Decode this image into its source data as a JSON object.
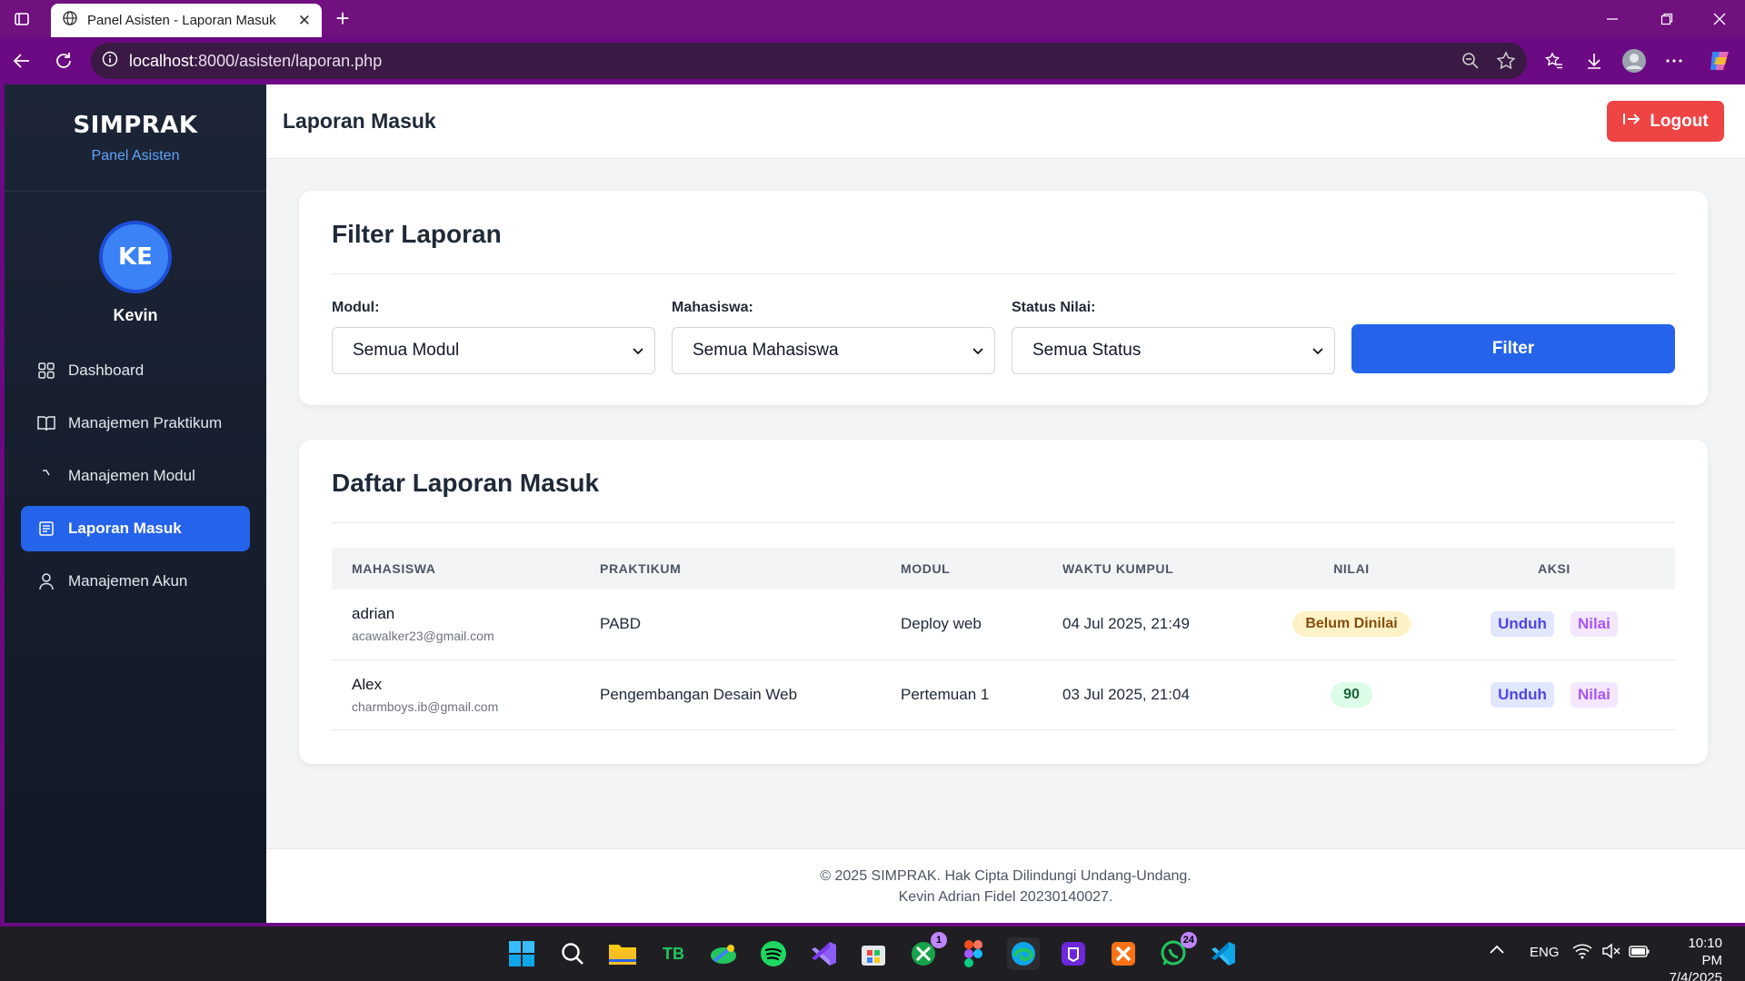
{
  "browser": {
    "tab_title": "Panel Asisten - Laporan Masuk",
    "url_host": "localhost",
    "url_rest": ":8000/asisten/laporan.php"
  },
  "sidebar": {
    "brand": "SIMPRAK",
    "subtitle": "Panel Asisten",
    "avatar_initials": "KE",
    "user_name": "Kevin",
    "items": [
      {
        "label": "Dashboard",
        "icon": "grid-icon"
      },
      {
        "label": "Manajemen Praktikum",
        "icon": "book-open-icon"
      },
      {
        "label": "Manajemen Modul",
        "icon": "corner-icon"
      },
      {
        "label": "Laporan Masuk",
        "icon": "report-icon",
        "active": true
      },
      {
        "label": "Manajemen Akun",
        "icon": "user-icon"
      }
    ]
  },
  "header": {
    "title": "Laporan Masuk",
    "logout_label": "Logout"
  },
  "filter": {
    "title": "Filter Laporan",
    "modul_label": "Modul:",
    "modul_value": "Semua Modul",
    "mahasiswa_label": "Mahasiswa:",
    "mahasiswa_value": "Semua Mahasiswa",
    "status_label": "Status Nilai:",
    "status_value": "Semua Status",
    "button_label": "Filter"
  },
  "reports": {
    "title": "Daftar Laporan Masuk",
    "columns": [
      "MAHASISWA",
      "PRAKTIKUM",
      "MODUL",
      "WAKTU KUMPUL",
      "NILAI",
      "AKSI"
    ],
    "rows": [
      {
        "name": "adrian",
        "email": "acawalker23@gmail.com",
        "praktikum": "PABD",
        "modul": "Deploy web",
        "waktu": "04 Jul 2025, 21:49",
        "nilai": "Belum Dinilai",
        "download": "Unduh",
        "grade": "Nilai"
      },
      {
        "name": "Alex",
        "email": "charmboys.ib@gmail.com",
        "praktikum": "Pengembangan Desain Web",
        "modul": "Pertemuan 1",
        "waktu": "03 Jul 2025, 21:04",
        "nilai": "90",
        "download": "Unduh",
        "grade": "Nilai"
      }
    ]
  },
  "footer": {
    "line1": "© 2025 SIMPRAK. Hak Cipta Dilindungi Undang-Undang.",
    "line2": "Kevin Adrian Fidel 20230140027."
  },
  "taskbar": {
    "lang": "ENG",
    "time": "10:10 PM",
    "date": "7/4/2025",
    "xbox_badge": "1",
    "whatsapp_badge": "24"
  },
  "colors": {
    "browser_frame": "#70117f",
    "sidebar_bg": "#111827",
    "primary": "#2563eb",
    "danger": "#ef4444"
  }
}
